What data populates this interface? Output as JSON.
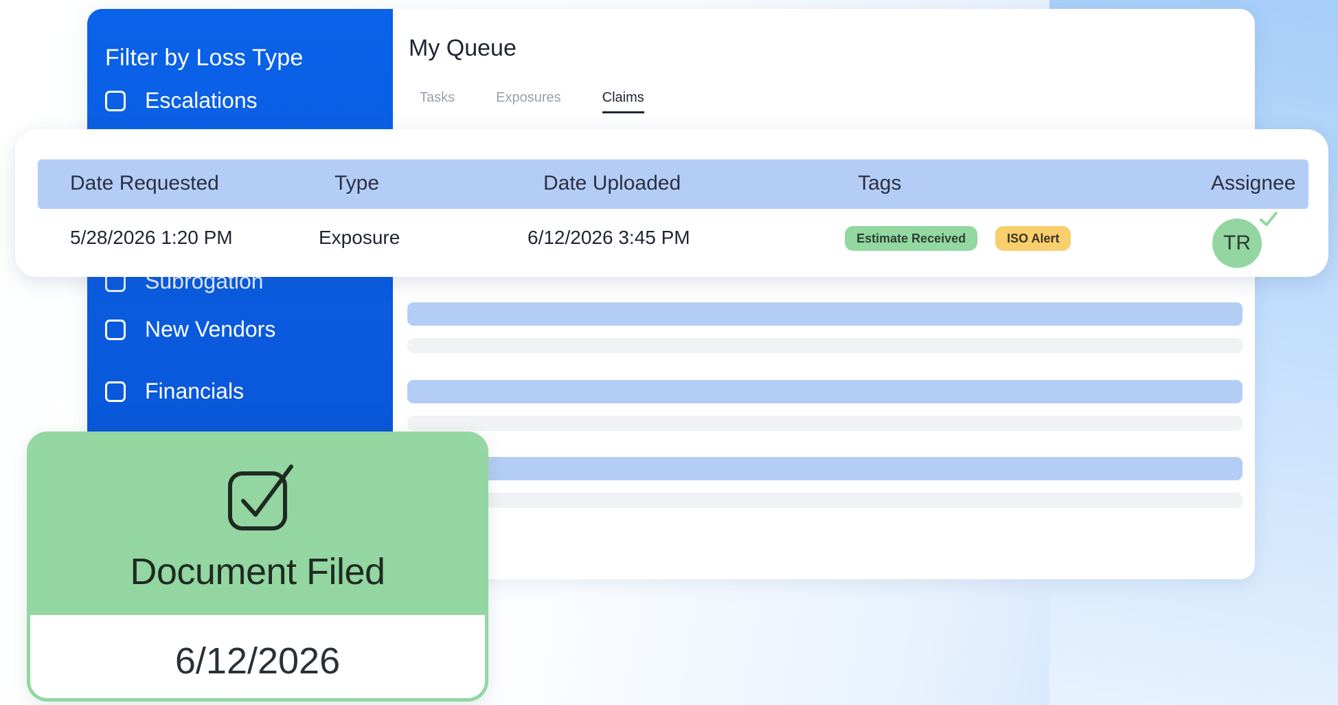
{
  "sidebar": {
    "title": "Filter by Loss Type",
    "items": [
      {
        "label": "Escalations"
      },
      {
        "label": "Subrogation"
      },
      {
        "label": "New Vendors"
      },
      {
        "label": "Financials"
      }
    ]
  },
  "main": {
    "title": "My Queue",
    "tabs": [
      {
        "label": "Tasks"
      },
      {
        "label": "Exposures"
      },
      {
        "label": "Claims",
        "active": true
      }
    ]
  },
  "table": {
    "columns": [
      "Date Requested",
      "Type",
      "Date Uploaded",
      "Tags",
      "Assignee"
    ],
    "rows": [
      {
        "date_requested": "5/28/2026 1:20 PM",
        "type": "Exposure",
        "date_uploaded": "6/12/2026 3:45 PM",
        "tags": [
          "Estimate Received",
          "ISO Alert"
        ],
        "assignee": "TR"
      }
    ]
  },
  "notification": {
    "title": "Document Filed",
    "date": "6/12/2026",
    "icon": "checkbox-check-icon"
  },
  "colors": {
    "sidebar_blue": "#0a5ee6",
    "header_blue": "#b4cdf7",
    "success_green": "#93d6a1",
    "alert_yellow": "#f8cf6c"
  }
}
